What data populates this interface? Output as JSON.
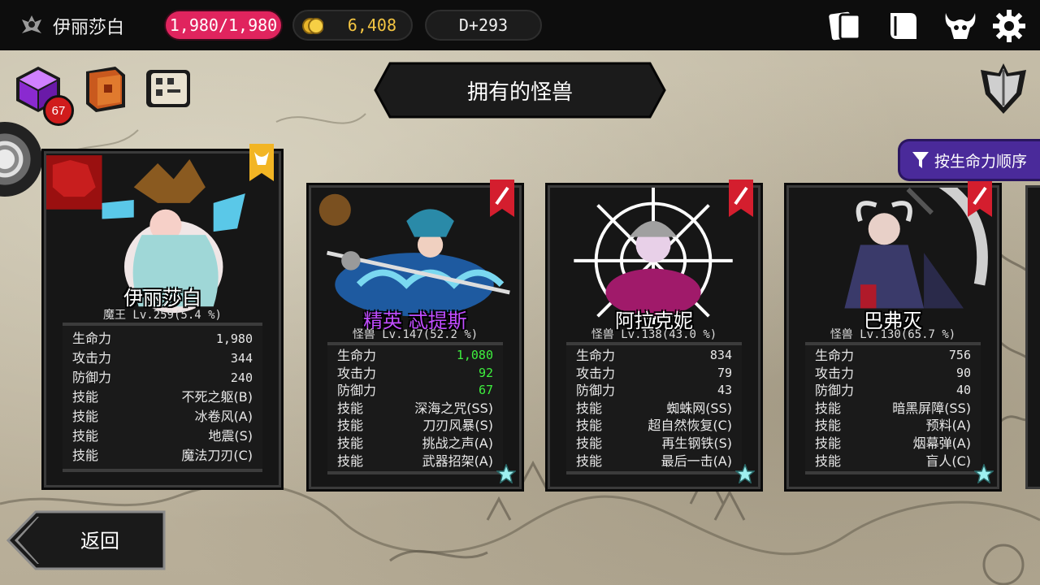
{
  "topbar": {
    "player_name": "伊丽莎白",
    "hp": "1,980/1,980",
    "gold": "6,408",
    "day": "D+293"
  },
  "quick": {
    "badge_count": "67"
  },
  "title": "拥有的怪兽",
  "sort_label": "按生命力顺序",
  "back_label": "返回",
  "stat_labels": {
    "hp": "生命力",
    "atk": "攻击力",
    "def": "防御力",
    "skill": "技能"
  },
  "cards": [
    {
      "name": "伊丽莎白",
      "rank": "魔王 Lv.259(5.4 %)",
      "elite": false,
      "hp": "1,980",
      "atk": "344",
      "def": "240",
      "skills": [
        "不死之躯(B)",
        "冰卷风(A)",
        "地震(S)",
        "魔法刀刃(C)"
      ]
    },
    {
      "name": "精英 忒提斯",
      "rank": "怪兽 Lv.147(52.2 %)",
      "elite": true,
      "hp": "1,080",
      "atk": "92",
      "def": "67",
      "skills": [
        "深海之咒(SS)",
        "刀刃风暴(S)",
        "挑战之声(A)",
        "武器招架(A)"
      ]
    },
    {
      "name": "阿拉克妮",
      "rank": "怪兽 Lv.138(43.0 %)",
      "elite": false,
      "hp": "834",
      "atk": "79",
      "def": "43",
      "skills": [
        "蜘蛛网(SS)",
        "超自然恢复(C)",
        "再生钢铁(S)",
        "最后一击(A)"
      ]
    },
    {
      "name": "巴弗灭",
      "rank": "怪兽 Lv.130(65.7 %)",
      "elite": false,
      "hp": "756",
      "atk": "90",
      "def": "40",
      "skills": [
        "暗黑屏障(SS)",
        "预料(A)",
        "烟幕弹(A)",
        "盲人(C)"
      ]
    }
  ]
}
